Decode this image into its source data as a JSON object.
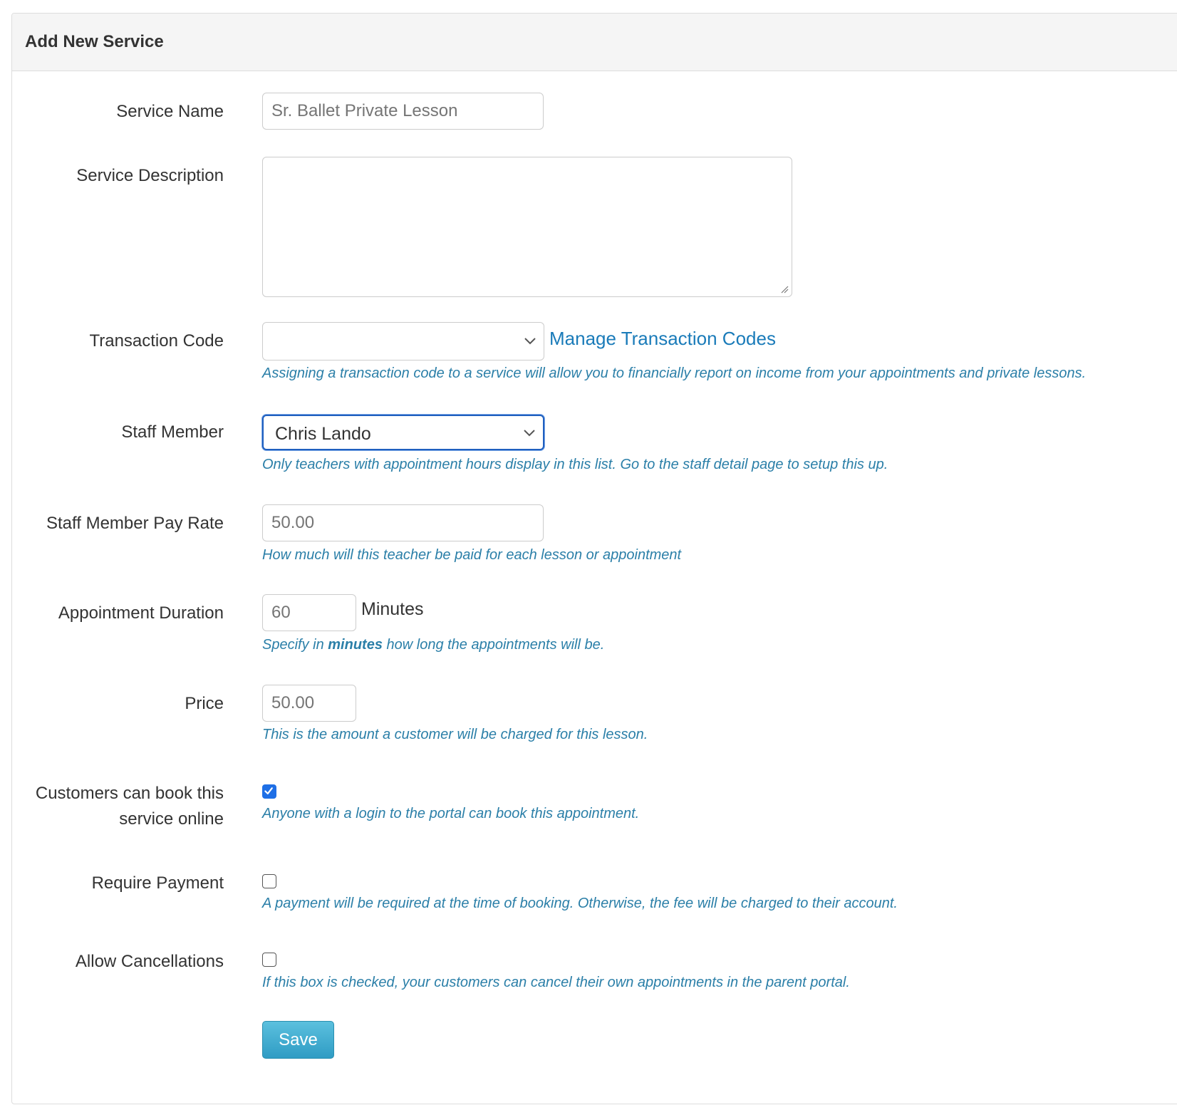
{
  "panel": {
    "title": "Add New Service"
  },
  "form": {
    "service_name": {
      "label": "Service Name",
      "placeholder": "Sr. Ballet Private Lesson"
    },
    "service_description": {
      "label": "Service Description",
      "value": ""
    },
    "transaction_code": {
      "label": "Transaction Code",
      "selected": "",
      "manage_link": "Manage Transaction Codes",
      "help": "Assigning a transaction code to a service will allow you to financially report on income from your appointments and private lessons."
    },
    "staff_member": {
      "label": "Staff Member",
      "selected": "Chris Lando",
      "help": "Only teachers with appointment hours display in this list. Go to the staff detail page to setup this up."
    },
    "pay_rate": {
      "label": "Staff Member Pay Rate",
      "placeholder": "50.00",
      "help": "How much will this teacher be paid for each lesson or appointment"
    },
    "duration": {
      "label": "Appointment Duration",
      "placeholder": "60",
      "unit": "Minutes",
      "help_pre": "Specify in ",
      "help_bold": "minutes",
      "help_post": " how long the appointments will be."
    },
    "price": {
      "label": "Price",
      "placeholder": "50.00",
      "help": "This is the amount a customer will be charged for this lesson."
    },
    "book_online": {
      "label_line1": "Customers can book this",
      "label_line2": "service online",
      "checked": true,
      "help": "Anyone with a login to the portal can book this appointment."
    },
    "require_payment": {
      "label": "Require Payment",
      "checked": false,
      "help": "A payment will be required at the time of booking. Otherwise, the fee will be charged to their account."
    },
    "allow_cancellations": {
      "label": "Allow Cancellations",
      "checked": false,
      "help": "If this box is checked, your customers can cancel their own appointments in the parent portal."
    },
    "save_label": "Save"
  },
  "colors": {
    "help_text": "#2b7fa8",
    "link": "#1a7bb9",
    "focus_border": "#1f5fbf",
    "checkbox_on": "#1e6fe6",
    "save_button": "#3aa8cf"
  }
}
